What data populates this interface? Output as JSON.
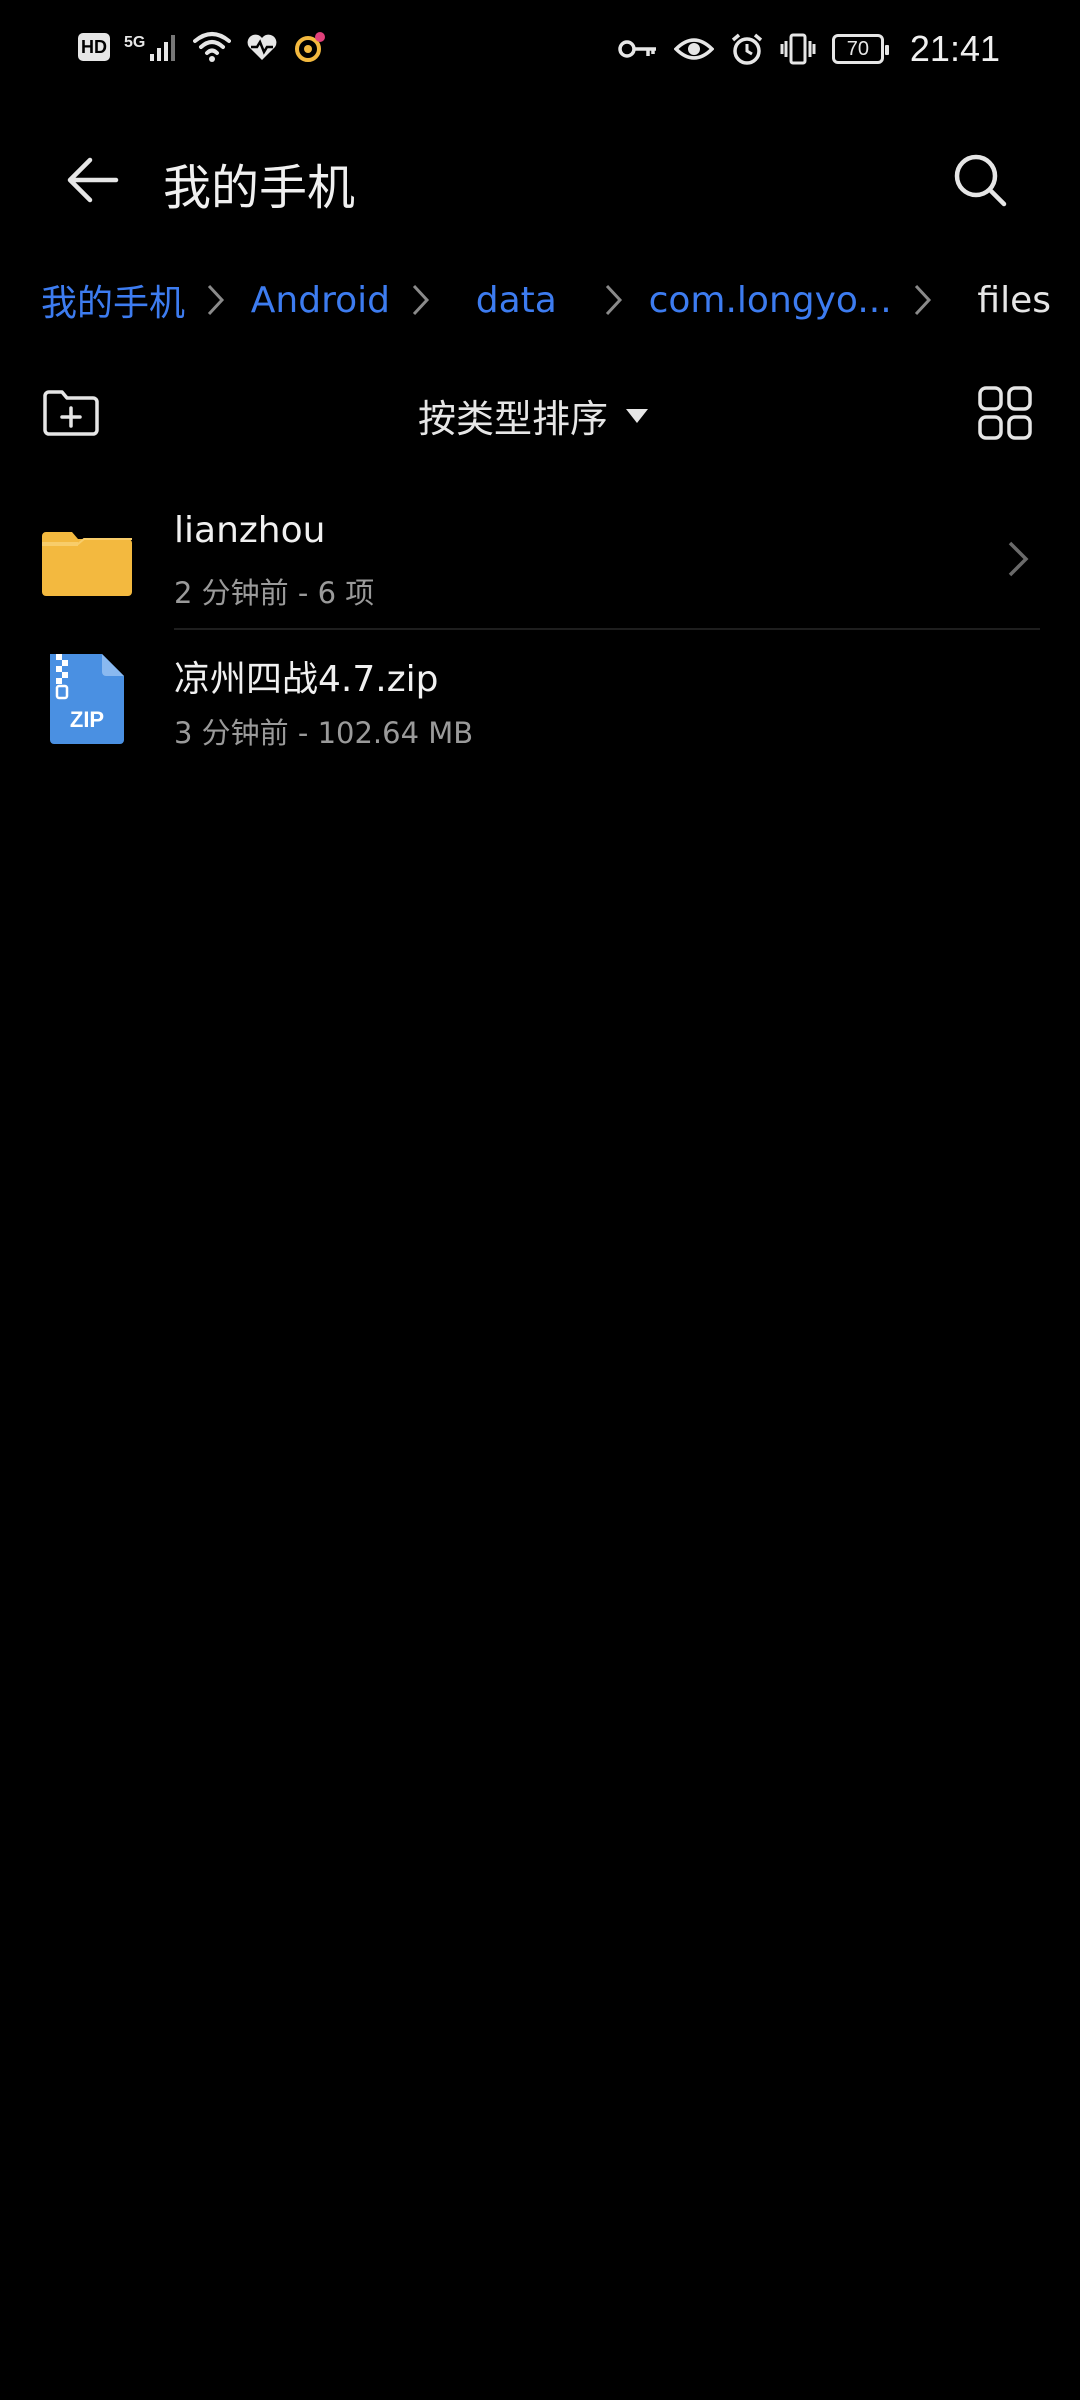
{
  "status_bar": {
    "hd_badge": "HD",
    "network": "5G",
    "battery": "70",
    "time": "21:41",
    "left_icons": [
      "hd-icon",
      "signal-icon",
      "wifi-icon",
      "health-icon",
      "notification-app-icon"
    ],
    "right_icons": [
      "key-icon",
      "eye-icon",
      "alarm-icon",
      "vibrate-icon",
      "battery-icon"
    ]
  },
  "header": {
    "title": "我的手机",
    "back_icon": "arrow-left-icon",
    "search_icon": "search-icon"
  },
  "breadcrumb": {
    "items": [
      "我的手机",
      "Android",
      "data",
      "com.longyo...",
      "files"
    ]
  },
  "toolbar": {
    "sort_label": "按类型排序",
    "new_folder_icon": "new-folder-icon",
    "grid_icon": "grid-view-icon"
  },
  "files": [
    {
      "name": "lianzhou",
      "meta": "2 分钟前 - 6 项",
      "type": "folder",
      "icon": "folder-icon"
    },
    {
      "name": "凉州四战4.7.zip",
      "meta": "3 分钟前 - 102.64 MB",
      "type": "zip",
      "icon": "zip-file-icon",
      "icon_label": "ZIP"
    }
  ],
  "colors": {
    "background": "#000000",
    "accent": "#3d7cf0",
    "folder": "#f3b93f",
    "zip": "#4a90e2",
    "text_primary": "#f0f0f0",
    "text_secondary": "#9a9a9a"
  }
}
